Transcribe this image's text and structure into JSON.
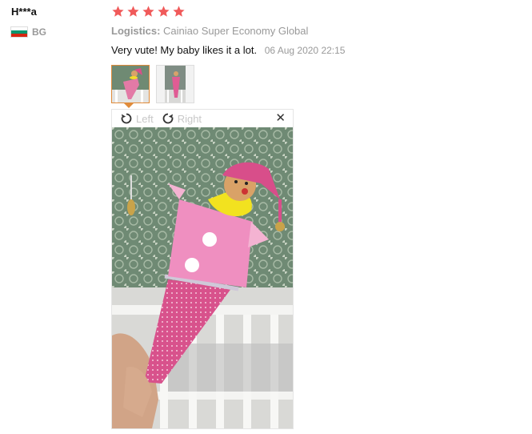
{
  "review": {
    "username": "H***a",
    "country_code": "BG",
    "flag_colors": [
      "#ffffff",
      "#00966e",
      "#d62612"
    ],
    "rating": 5,
    "star_color": "#f05a5a",
    "logistics_label": "Logistics:",
    "logistics_value": "Cainiao Super Economy Global",
    "text": "Very vute! My baby likes it a lot.",
    "date": "06 Aug 2020 22:15"
  },
  "viewer": {
    "rotate_left_label": "Left",
    "rotate_right_label": "Right",
    "close_icon": "close-icon",
    "active_thumb_color": "#e08b3a"
  }
}
